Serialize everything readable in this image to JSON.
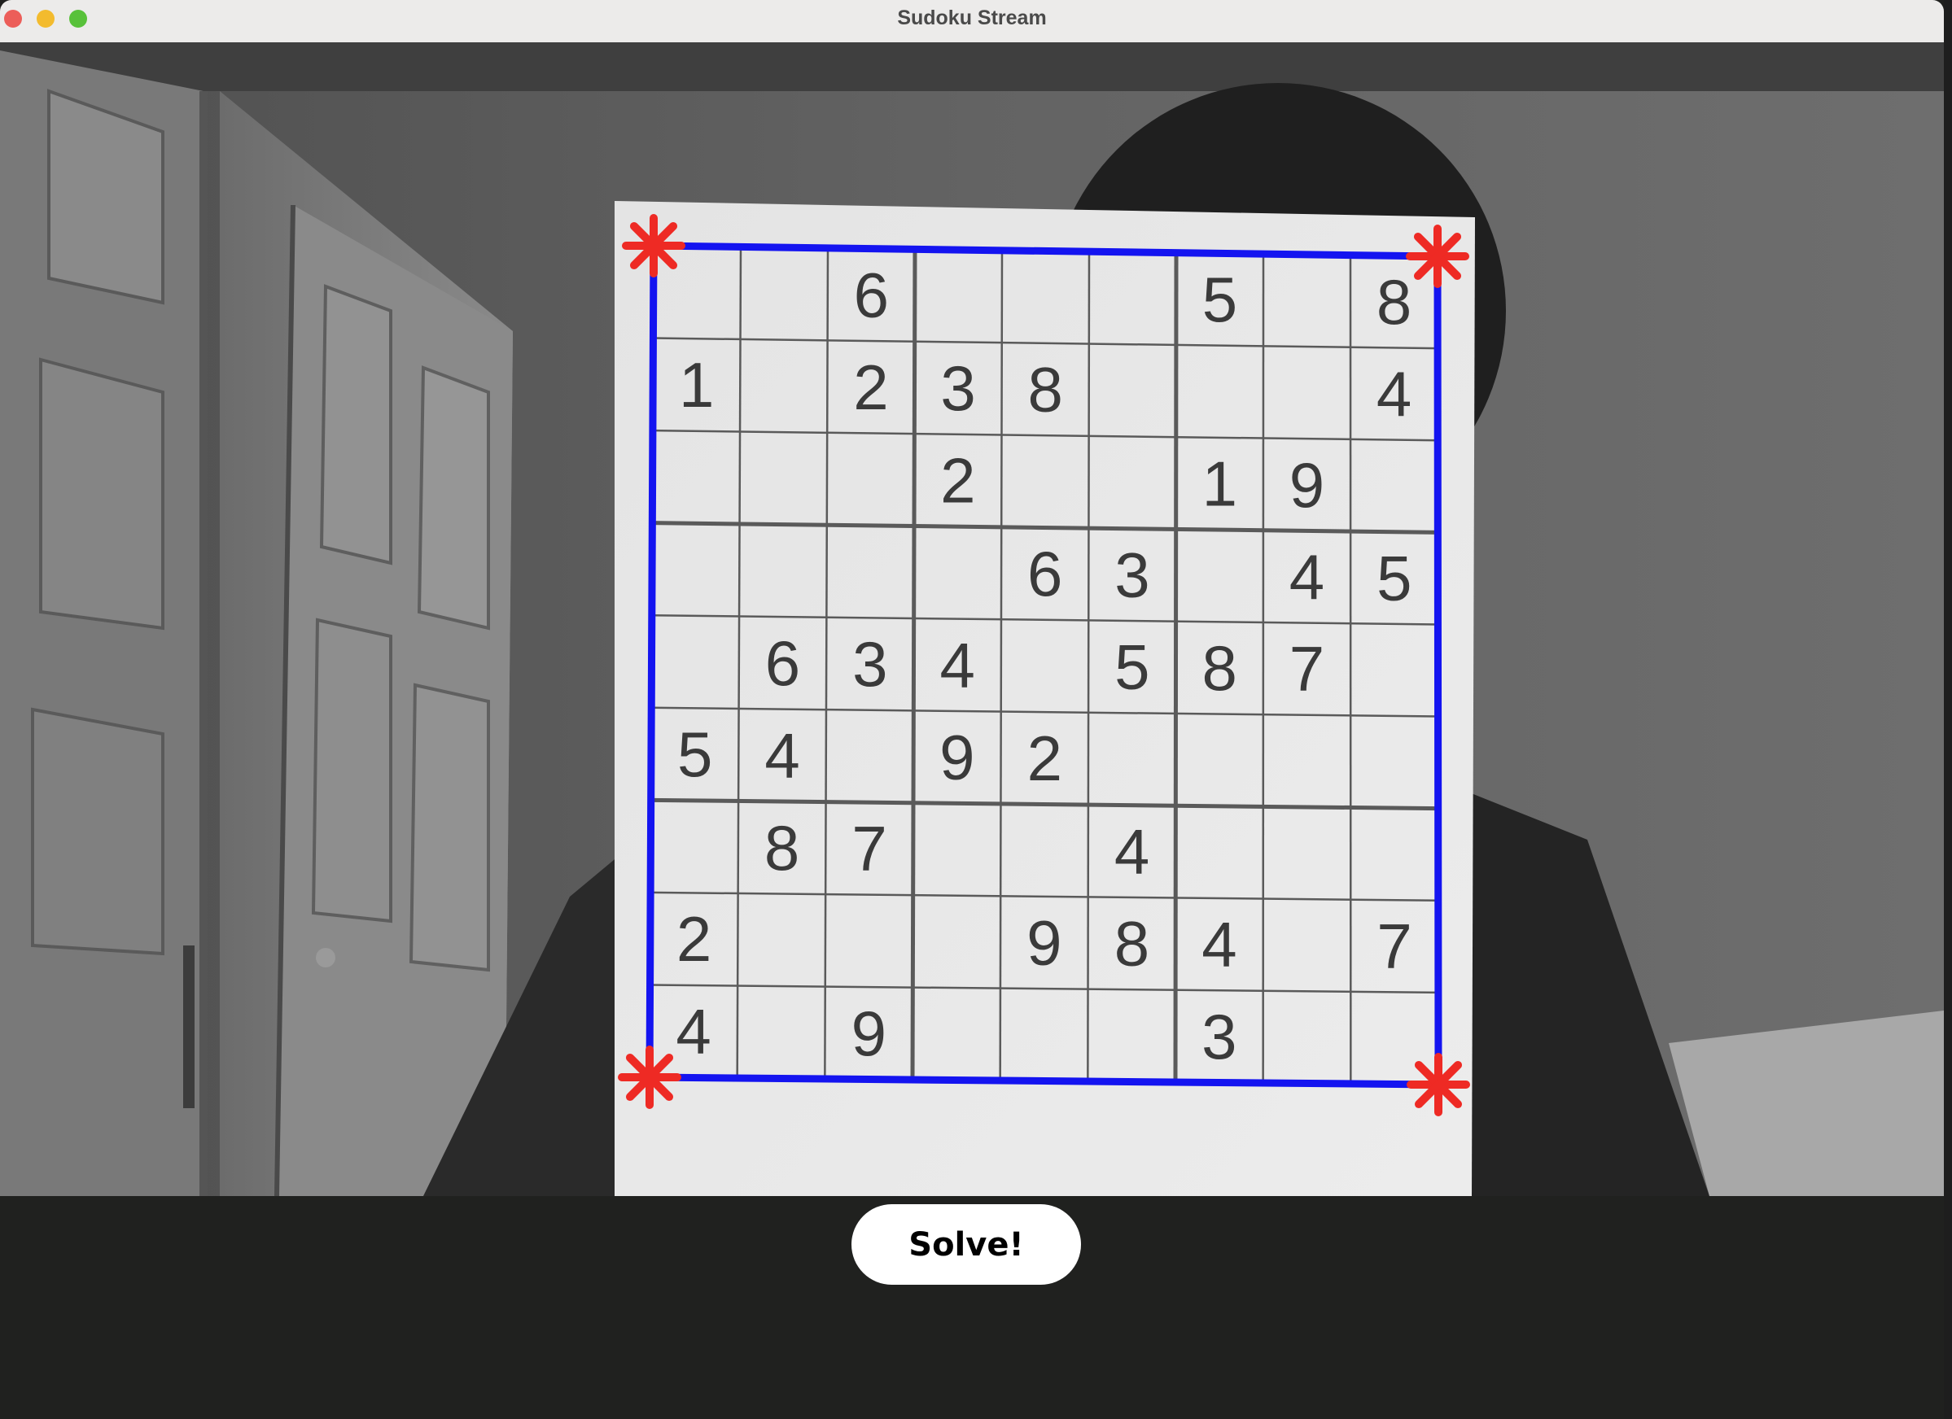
{
  "window": {
    "title": "Sudoku Stream"
  },
  "camera_view": {
    "description_free": true,
    "grid_overlay_color": "#1414f0",
    "corner_marker_color": "#ee2a24",
    "grid": [
      [
        null,
        null,
        6,
        null,
        null,
        null,
        5,
        null,
        8
      ],
      [
        1,
        null,
        2,
        3,
        8,
        null,
        null,
        null,
        4
      ],
      [
        null,
        null,
        null,
        2,
        null,
        null,
        1,
        9,
        null
      ],
      [
        null,
        null,
        null,
        null,
        6,
        3,
        null,
        4,
        5
      ],
      [
        null,
        6,
        3,
        4,
        null,
        5,
        8,
        7,
        null
      ],
      [
        5,
        4,
        null,
        9,
        2,
        null,
        null,
        null,
        null
      ],
      [
        null,
        8,
        7,
        null,
        null,
        4,
        null,
        null,
        null
      ],
      [
        2,
        null,
        null,
        null,
        9,
        8,
        4,
        null,
        7
      ],
      [
        4,
        null,
        9,
        null,
        null,
        null,
        3,
        null,
        null
      ]
    ]
  },
  "controls": {
    "solve_label": "Solve!"
  },
  "colors": {
    "titlebar": "#ecebea",
    "app_background": "#20211f",
    "button_background": "#ffffff",
    "close": "#ec5e59",
    "minimize": "#f3bb2e",
    "maximize": "#58c13a"
  }
}
